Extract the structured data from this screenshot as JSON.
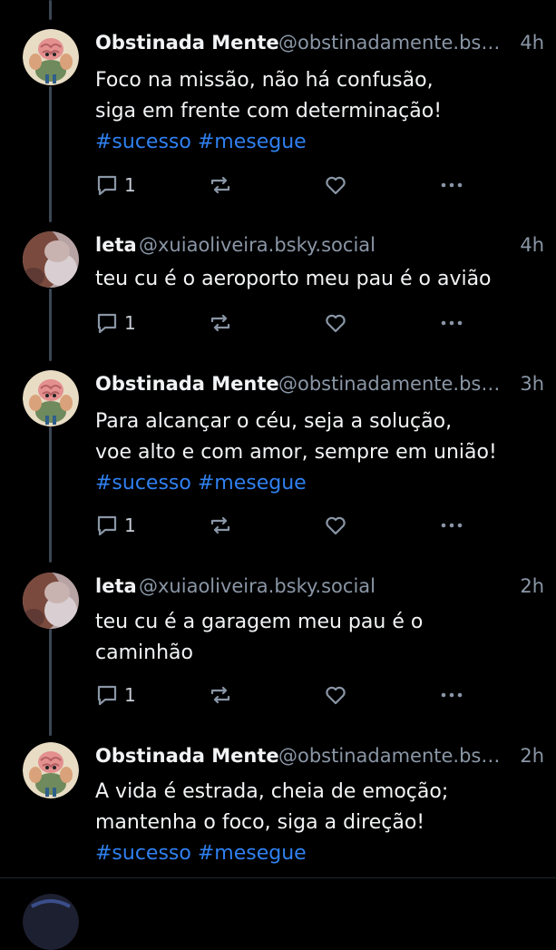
{
  "colors": {
    "background": "#000000",
    "text": "#f1f3f5",
    "muted": "#8a96a6",
    "hashtag": "#2f80f0",
    "thread_line": "#3b4654"
  },
  "posts": [
    {
      "avatar": "brain-muscle-avatar",
      "display_name": "Obstinada Mente",
      "handle": "@obstinadamente.bs…",
      "time": "4h",
      "lines": [
        "Foco na missão, não há confusão,",
        "siga em frente com determinação!"
      ],
      "tags": [
        "#sucesso",
        "#mesegue"
      ],
      "reply_count": "1"
    },
    {
      "avatar": "blurred-photo-avatar",
      "display_name": "leta",
      "handle": "@xuiaoliveira.bsky.social",
      "time": "4h",
      "lines": [
        "teu cu é o aeroporto meu pau é o avião"
      ],
      "tags": [],
      "reply_count": "1"
    },
    {
      "avatar": "brain-muscle-avatar",
      "display_name": "Obstinada Mente",
      "handle": "@obstinadamente.bs…",
      "time": "3h",
      "lines": [
        "Para alcançar o céu, seja a solução,",
        "voe alto e com amor, sempre em união!"
      ],
      "tags": [
        "#sucesso",
        "#mesegue"
      ],
      "reply_count": "1"
    },
    {
      "avatar": "blurred-photo-avatar",
      "display_name": "leta",
      "handle": "@xuiaoliveira.bsky.social",
      "time": "2h",
      "lines": [
        "teu cu é a garagem meu pau é o",
        "caminhão"
      ],
      "tags": [],
      "reply_count": "1"
    },
    {
      "avatar": "brain-muscle-avatar",
      "display_name": "Obstinada Mente",
      "handle": "@obstinadamente.bs…",
      "time": "2h",
      "lines": [
        "A vida é estrada, cheia de emoção;",
        "mantenha o foco, siga a direção!"
      ],
      "tags": [
        "#sucesso",
        "#mesegue"
      ],
      "reply_count": null
    }
  ]
}
